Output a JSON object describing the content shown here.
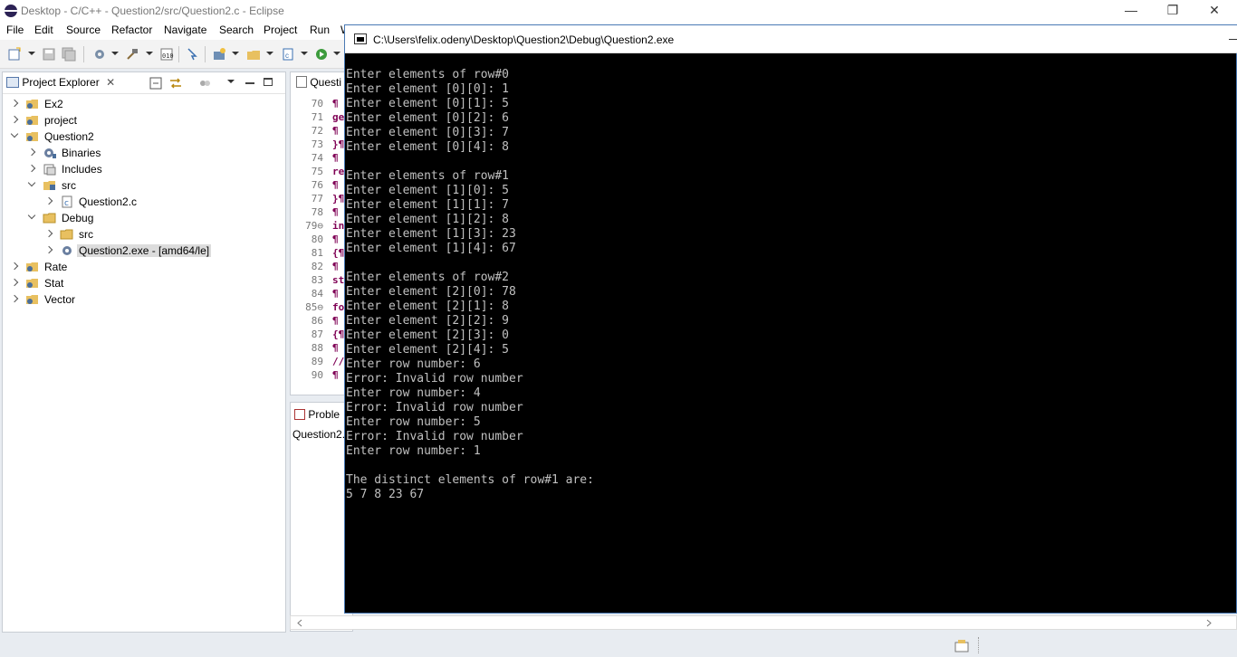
{
  "window": {
    "title": "Desktop - C/C++ - Question2/src/Question2.c - Eclipse",
    "minimize": "—",
    "restore": "❐",
    "close": "✕"
  },
  "menu": [
    "File",
    "Edit",
    "Source",
    "Refactor",
    "Navigate",
    "Search",
    "Project",
    "Run",
    "W"
  ],
  "explorer": {
    "tab_label": "Project Explorer",
    "close_glyph": "✕",
    "tree": [
      {
        "label": "Ex2",
        "icon": "project-icon",
        "expanded": false
      },
      {
        "label": "project",
        "icon": "project-icon",
        "expanded": false
      },
      {
        "label": "Question2",
        "icon": "project-icon",
        "expanded": true
      },
      {
        "label": "Binaries",
        "icon": "binaries-icon",
        "expanded": false
      },
      {
        "label": "Includes",
        "icon": "includes-icon",
        "expanded": false
      },
      {
        "label": "src",
        "icon": "source-folder-icon",
        "expanded": true
      },
      {
        "label": "Question2.c",
        "icon": "c-file-icon",
        "expanded": false
      },
      {
        "label": "Debug",
        "icon": "folder-icon",
        "expanded": true
      },
      {
        "label": "src",
        "icon": "folder-icon",
        "expanded": false
      },
      {
        "label": "Question2.exe - [amd64/le]",
        "icon": "executable-icon",
        "expanded": false,
        "selected": true
      },
      {
        "label": "Rate",
        "icon": "project-icon",
        "expanded": false
      },
      {
        "label": "Stat",
        "icon": "project-icon",
        "expanded": false
      },
      {
        "label": "Vector",
        "icon": "project-icon",
        "expanded": false
      }
    ]
  },
  "editor": {
    "tab_label": "Questi",
    "lines": [
      {
        "num": "70",
        "code": "¶"
      },
      {
        "num": "71",
        "code": "ge"
      },
      {
        "num": "72",
        "code": "¶"
      },
      {
        "num": "73",
        "code": "}¶"
      },
      {
        "num": "74",
        "code": "¶"
      },
      {
        "num": "75",
        "code": "re"
      },
      {
        "num": "76",
        "code": "¶"
      },
      {
        "num": "77",
        "code": "}¶"
      },
      {
        "num": "78",
        "code": "¶"
      },
      {
        "num": "79⊖",
        "code": "in"
      },
      {
        "num": "80",
        "code": "¶"
      },
      {
        "num": "81",
        "code": "{¶"
      },
      {
        "num": "82",
        "code": "¶"
      },
      {
        "num": "83",
        "code": "st"
      },
      {
        "num": "84",
        "code": "¶"
      },
      {
        "num": "85⊖",
        "code": "fo"
      },
      {
        "num": "86",
        "code": "¶"
      },
      {
        "num": "87",
        "code": "{¶"
      },
      {
        "num": "88",
        "code": "¶"
      },
      {
        "num": "89",
        "code": "//"
      },
      {
        "num": "90",
        "code": "¶"
      }
    ]
  },
  "problems": {
    "tab_label": "Proble",
    "item": "Question2."
  },
  "console": {
    "title": "C:\\Users\\felix.odeny\\Desktop\\Question2\\Debug\\Question2.exe",
    "output": "Enter elements of row#0\nEnter element [0][0]: 1\nEnter element [0][1]: 5\nEnter element [0][2]: 6\nEnter element [0][3]: 7\nEnter element [0][4]: 8\n\nEnter elements of row#1\nEnter element [1][0]: 5\nEnter element [1][1]: 7\nEnter element [1][2]: 8\nEnter element [1][3]: 23\nEnter element [1][4]: 67\n\nEnter elements of row#2\nEnter element [2][0]: 78\nEnter element [2][1]: 8\nEnter element [2][2]: 9\nEnter element [2][3]: 0\nEnter element [2][4]: 5\nEnter row number: 6\nError: Invalid row number\nEnter row number: 4\nError: Invalid row number\nEnter row number: 5\nError: Invalid row number\nEnter row number: 1\n\nThe distinct elements of row#1 are:\n5 7 8 23 67"
  },
  "colors": {
    "console_bg": "#000000",
    "console_text": "#c0c0c0",
    "keyword": "#7f0055",
    "selection": "#dcdcdc"
  }
}
